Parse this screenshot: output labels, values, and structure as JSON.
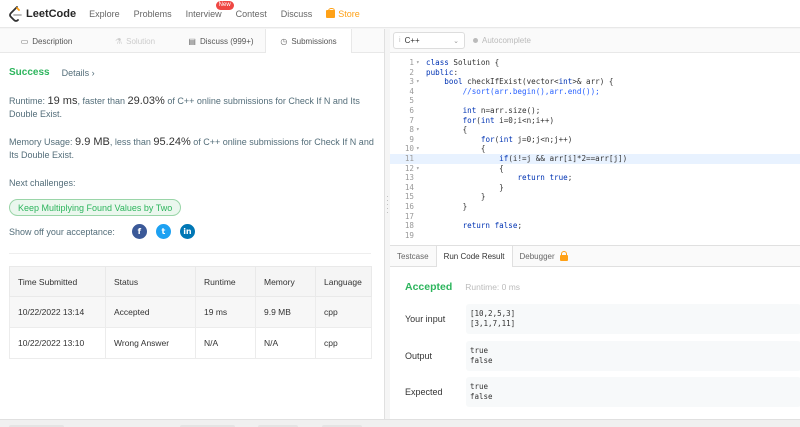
{
  "nav": {
    "logo": "LeetCode",
    "items": [
      "Explore",
      "Problems",
      "Interview",
      "Contest",
      "Discuss",
      "Store"
    ],
    "new_badge": "New"
  },
  "left_tabs": [
    {
      "label": "Description",
      "icon": "document-icon"
    },
    {
      "label": "Solution",
      "icon": "flask-icon"
    },
    {
      "label": "Discuss (999+)",
      "icon": "chat-icon"
    },
    {
      "label": "Submissions",
      "icon": "clock-icon"
    }
  ],
  "result": {
    "status": "Success",
    "details": "Details",
    "runtime_prefix": "Runtime: ",
    "runtime_value": "19 ms",
    "runtime_mid": ", faster than ",
    "runtime_pct": "29.03%",
    "runtime_suffix": " of C++ online submissions for Check If N and Its Double Exist.",
    "memory_prefix": "Memory Usage: ",
    "memory_value": "9.9 MB",
    "memory_mid": ", less than ",
    "memory_pct": "95.24%",
    "memory_suffix": " of C++ online submissions for Check If N and Its Double Exist.",
    "next_label": "Next challenges:",
    "next_challenge": "Keep Multiplying Found Values by Two",
    "share_label": "Show off your acceptance:",
    "share_icons": [
      "facebook-icon",
      "twitter-icon",
      "linkedin-icon"
    ]
  },
  "submissions": {
    "headers": [
      "Time Submitted",
      "Status",
      "Runtime",
      "Memory",
      "Language"
    ],
    "rows": [
      [
        "10/22/2022 13:14",
        "Accepted",
        "19 ms",
        "9.9 MB",
        "cpp"
      ],
      [
        "10/22/2022 13:10",
        "Wrong Answer",
        "N/A",
        "N/A",
        "cpp"
      ]
    ]
  },
  "editor": {
    "language": "C++",
    "autocomplete": "Autocomplete",
    "highlight_line": 11,
    "lines": [
      {
        "n": "1",
        "fold": "▾",
        "text": "class Solution {"
      },
      {
        "n": "2",
        "fold": "",
        "text": "public:"
      },
      {
        "n": "3",
        "fold": "▾",
        "text": "    bool checkIfExist(vector<int>& arr) {"
      },
      {
        "n": "4",
        "fold": "",
        "text": "        //sort(arr.begin(),arr.end());"
      },
      {
        "n": "5",
        "fold": "",
        "text": ""
      },
      {
        "n": "6",
        "fold": "",
        "text": "        int n=arr.size();"
      },
      {
        "n": "7",
        "fold": "",
        "text": "        for(int i=0;i<n;i++)"
      },
      {
        "n": "8",
        "fold": "▾",
        "text": "        {"
      },
      {
        "n": "9",
        "fold": "",
        "text": "            for(int j=0;j<n;j++)"
      },
      {
        "n": "10",
        "fold": "▾",
        "text": "            {"
      },
      {
        "n": "11",
        "fold": "",
        "text": "                if(i!=j && arr[i]*2==arr[j])"
      },
      {
        "n": "12",
        "fold": "▾",
        "text": "                {"
      },
      {
        "n": "13",
        "fold": "",
        "text": "                    return true;"
      },
      {
        "n": "14",
        "fold": "",
        "text": "                }"
      },
      {
        "n": "15",
        "fold": "",
        "text": "            }"
      },
      {
        "n": "16",
        "fold": "",
        "text": "        }"
      },
      {
        "n": "17",
        "fold": "",
        "text": ""
      },
      {
        "n": "18",
        "fold": "",
        "text": "        return false;"
      },
      {
        "n": "19",
        "fold": "",
        "text": ""
      }
    ]
  },
  "bottom_tabs": [
    "Testcase",
    "Run Code Result",
    "Debugger"
  ],
  "run_result": {
    "status": "Accepted",
    "runtime": "Runtime: 0 ms",
    "input_label": "Your input",
    "input_lines": [
      "[10,2,5,3]",
      "[3,1,7,11]"
    ],
    "output_label": "Output",
    "output_lines": [
      "true",
      "false"
    ],
    "expected_label": "Expected",
    "expected_lines": [
      "true",
      "false"
    ]
  }
}
